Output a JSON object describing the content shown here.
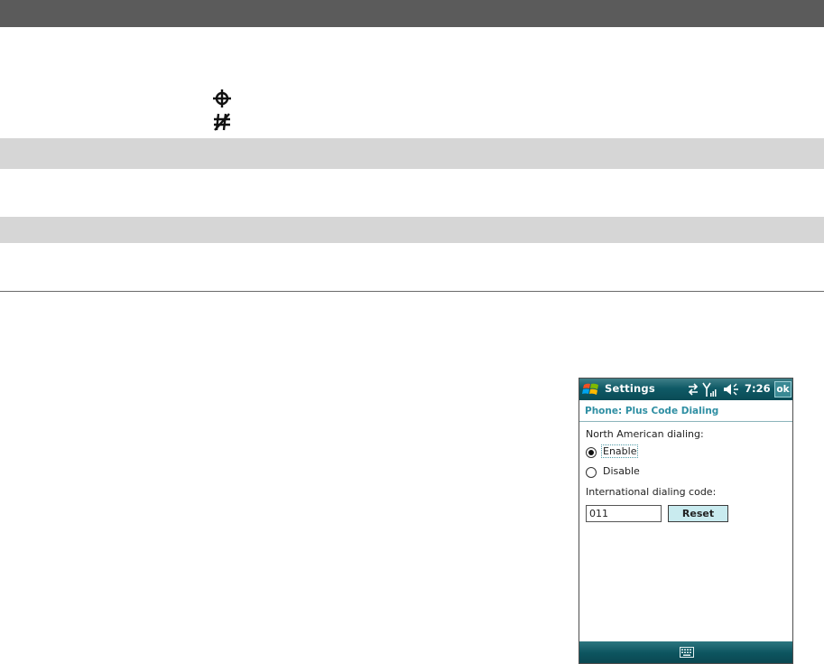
{
  "device": {
    "titlebar": {
      "title": "Settings",
      "time": "7:26",
      "ok_label": "ok"
    },
    "heading": "Phone: Plus Code Dialing",
    "north_american_label": "North American dialing:",
    "options": [
      {
        "label": "Enable",
        "selected": true
      },
      {
        "label": "Disable",
        "selected": false
      }
    ],
    "intl_code_label": "International dialing code:",
    "intl_code_value": "011",
    "reset_label": "Reset"
  },
  "colors": {
    "titlebar": "#0f5a66",
    "heading": "#2f8fa3",
    "reset_button": "#c9ebef"
  }
}
